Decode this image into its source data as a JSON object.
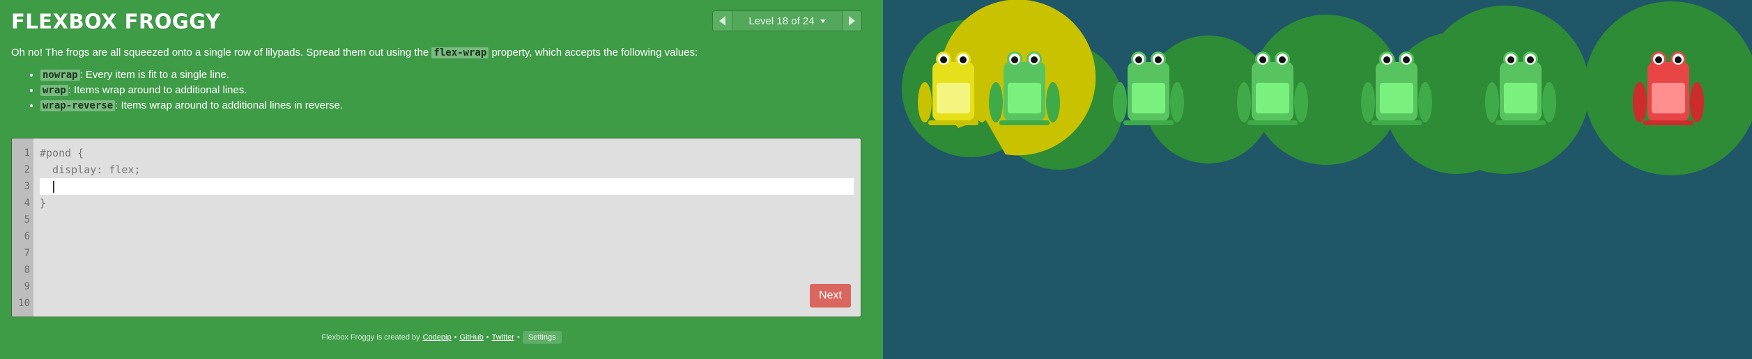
{
  "app": {
    "title": "FLEXBOX FROGGY"
  },
  "level_nav": {
    "label": "Level 18 of 24"
  },
  "instructions": {
    "intro_before": "Oh no! The frogs are all squeezed onto a single row of lilypads. Spread them out using the ",
    "intro_code": "flex-wrap",
    "intro_after": " property, which accepts the following values:",
    "values": [
      {
        "code": "nowrap",
        "text": ": Every item is fit to a single line."
      },
      {
        "code": "wrap",
        "text": ": Items wrap around to additional lines."
      },
      {
        "code": "wrap-reverse",
        "text": ": Items wrap around to additional lines in reverse."
      }
    ]
  },
  "editor": {
    "line_numbers": [
      "1",
      "2",
      "3",
      "4",
      "5",
      "6",
      "7",
      "8",
      "9",
      "10"
    ],
    "line1": "#pond {",
    "line2": "  display: flex;",
    "line3_value": "",
    "line4": "}",
    "next_label": "Next"
  },
  "footer": {
    "created_by": "Flexbox Froggy is created by",
    "codepip": "Codepip",
    "sep1": "•",
    "github": "GitHub",
    "sep2": "•",
    "twitter": "Twitter",
    "sep3": "•",
    "settings": "Settings"
  },
  "pond": {
    "colors": {
      "water": "#1f5768",
      "green_pad": "#2e8b36",
      "yellow_pad": "#c9c200",
      "red_frog": "#e84646",
      "green_frog": "#57c45f",
      "yellow_frog": "#e6e01b"
    },
    "lilypads": [
      "yellow",
      "green",
      "green",
      "green",
      "green",
      "green",
      "green"
    ],
    "frogs": [
      "yellow",
      "green",
      "green",
      "green",
      "green",
      "green",
      "red"
    ]
  }
}
